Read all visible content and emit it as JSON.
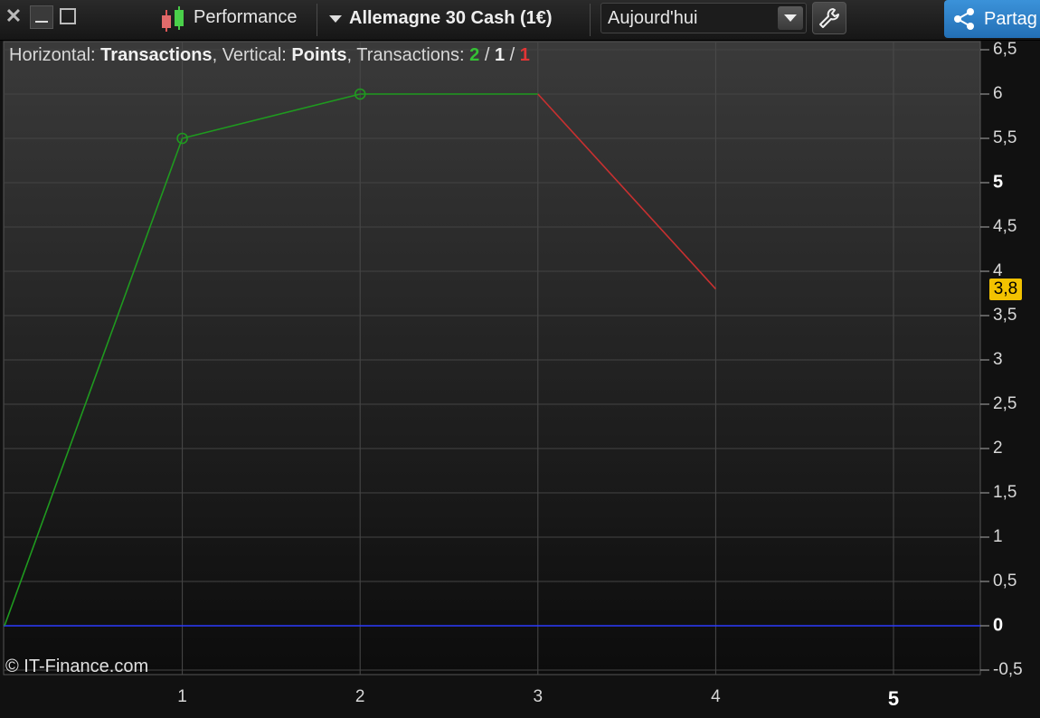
{
  "toolbar": {
    "performance_label": "Performance",
    "instrument_label": "Allemagne 30 Cash (1€)",
    "period_value": "Aujourd'hui",
    "share_label": "Partag",
    "icons": [
      "close-icon",
      "minimize-icon",
      "maximize-icon",
      "candlestick-icon",
      "dropdown-caret-icon",
      "wrench-icon",
      "share-icon"
    ]
  },
  "info": {
    "horizontal_label": "Horizontal:",
    "horizontal_value": "Transactions",
    "vertical_label": "Vertical:",
    "vertical_value": "Points",
    "transactions_label": "Transactions:",
    "win_count": "2",
    "neutral_count": "1",
    "loss_count": "1",
    "sep1": ",",
    "sep2": ",",
    "slash": "/"
  },
  "copyright": "© IT-Finance.com",
  "last_value_badge": "3,8",
  "colors": {
    "gain": "#1f9a1f",
    "loss": "#c83030",
    "zero_line": "#2b3bff",
    "badge": "#f2c200",
    "share_button": "#2a7cc6"
  },
  "chart_data": {
    "type": "line",
    "xlabel": "",
    "ylabel": "",
    "xlim": [
      0,
      5.5
    ],
    "ylim": [
      -0.5,
      6.5
    ],
    "grid": true,
    "x_ticks": [
      "1",
      "2",
      "3",
      "4",
      "5"
    ],
    "y_ticks": [
      "6,5",
      "6",
      "5,5",
      "5",
      "4,5",
      "4",
      "3,5",
      "3",
      "2,5",
      "2",
      "1,5",
      "1",
      "0,5",
      "0",
      "-0,5"
    ],
    "bold_y_ticks": [
      "5",
      "0"
    ],
    "bold_x_ticks": [
      "5"
    ],
    "points": [
      {
        "x": 0,
        "y": 0
      },
      {
        "x": 1,
        "y": 5.5
      },
      {
        "x": 2,
        "y": 6
      },
      {
        "x": 3,
        "y": 6
      },
      {
        "x": 4,
        "y": 3.8
      }
    ],
    "segment_colors": [
      "gain",
      "gain",
      "gain",
      "loss"
    ],
    "markers_at_x": [
      1,
      2
    ],
    "zero_line": 0,
    "last_value": 3.8
  }
}
